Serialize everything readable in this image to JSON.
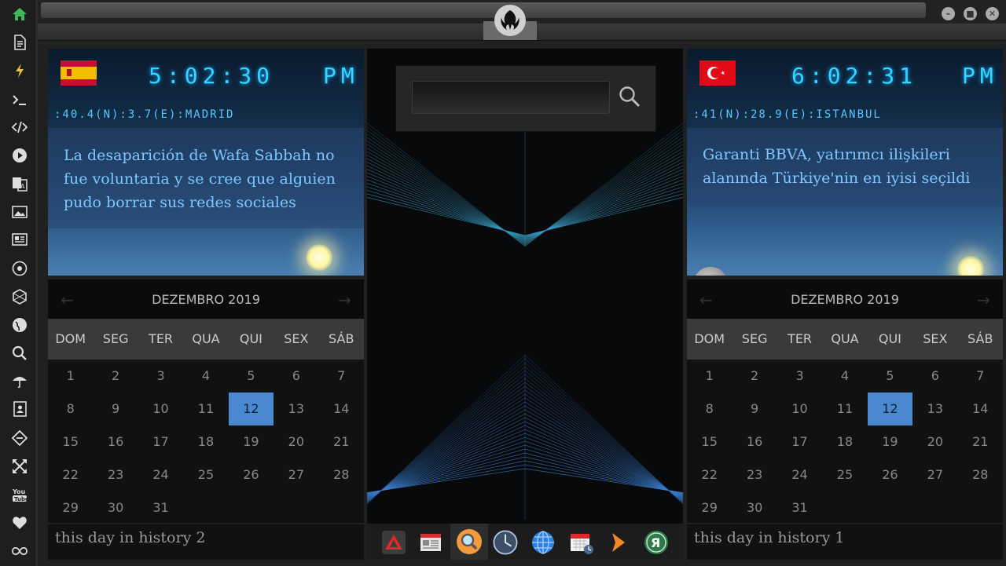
{
  "sidebar": {
    "items": [
      {
        "icon": "home-icon",
        "color": "#3dbb5a"
      },
      {
        "icon": "document-icon"
      },
      {
        "icon": "lightning-icon",
        "color": "#e8c23a"
      },
      {
        "icon": "terminal-icon"
      },
      {
        "icon": "code-icon"
      },
      {
        "icon": "play-icon"
      },
      {
        "icon": "translate-icon"
      },
      {
        "icon": "image-icon"
      },
      {
        "icon": "news-icon"
      },
      {
        "icon": "rebel-alliance-icon"
      },
      {
        "icon": "hexagon-icon"
      },
      {
        "icon": "globe-icon"
      },
      {
        "icon": "search-icon"
      },
      {
        "icon": "umbrella-icon"
      },
      {
        "icon": "contact-card-icon"
      },
      {
        "icon": "tag-icon"
      },
      {
        "icon": "expand-icon"
      },
      {
        "icon": "youtube-icon"
      },
      {
        "icon": "heart-icon"
      },
      {
        "icon": "infinity-icon"
      }
    ]
  },
  "window": {
    "controls": [
      "minimize",
      "maximize",
      "close"
    ]
  },
  "clock_left": {
    "time": "5:02:30",
    "ampm": "PM",
    "coords": ":40.4(N):3.7(E):MADRID",
    "headline": "La desaparición de Wafa Sabbah no fue voluntaria y se cree que alguien pudo borrar sus redes sociales",
    "flag": "spain-flag"
  },
  "clock_right": {
    "time": "6:02:31",
    "ampm": "PM",
    "coords": ":41(N):28.9(E):ISTANBUL",
    "headline": "Garanti BBVA, yatırımcı ilişkileri alanında Türkiye'nin en iyisi seçildi",
    "flag": "turkey-flag"
  },
  "calendar_left": {
    "month": "DEZEMBRO 2019",
    "days": [
      "DOM",
      "SEG",
      "TER",
      "QUA",
      "QUI",
      "SEX",
      "SÁB"
    ],
    "weeks": [
      [
        "1",
        "2",
        "3",
        "4",
        "5",
        "6",
        "7"
      ],
      [
        "8",
        "9",
        "10",
        "11",
        "12",
        "13",
        "14"
      ],
      [
        "15",
        "16",
        "17",
        "18",
        "19",
        "20",
        "21"
      ],
      [
        "22",
        "23",
        "24",
        "25",
        "26",
        "27",
        "28"
      ],
      [
        "29",
        "30",
        "31",
        "",
        "",
        "",
        ""
      ]
    ],
    "today": "12"
  },
  "calendar_right": {
    "month": "DEZEMBRO 2019",
    "days": [
      "DOM",
      "SEG",
      "TER",
      "QUA",
      "QUI",
      "SEX",
      "SÁB"
    ],
    "weeks": [
      [
        "1",
        "2",
        "3",
        "4",
        "5",
        "6",
        "7"
      ],
      [
        "8",
        "9",
        "10",
        "11",
        "12",
        "13",
        "14"
      ],
      [
        "15",
        "16",
        "17",
        "18",
        "19",
        "20",
        "21"
      ],
      [
        "22",
        "23",
        "24",
        "25",
        "26",
        "27",
        "28"
      ],
      [
        "29",
        "30",
        "31",
        "",
        "",
        "",
        ""
      ]
    ],
    "today": "12"
  },
  "history_left": "this day in history 2",
  "history_right": "this day in history 1",
  "search": {
    "placeholder": "",
    "value": ""
  },
  "dock": [
    {
      "icon": "red-triangle-app-icon"
    },
    {
      "icon": "news-reader-icon"
    },
    {
      "icon": "search-app-icon",
      "active": true
    },
    {
      "icon": "clock-app-icon"
    },
    {
      "icon": "globe-app-icon"
    },
    {
      "icon": "calendar-app-icon"
    },
    {
      "icon": "arrow-app-icon"
    },
    {
      "icon": "yandex-icon"
    }
  ],
  "colors": {
    "accent": "#4a88d0",
    "digital": "#33d6ff",
    "headline": "#7ec8ff"
  }
}
